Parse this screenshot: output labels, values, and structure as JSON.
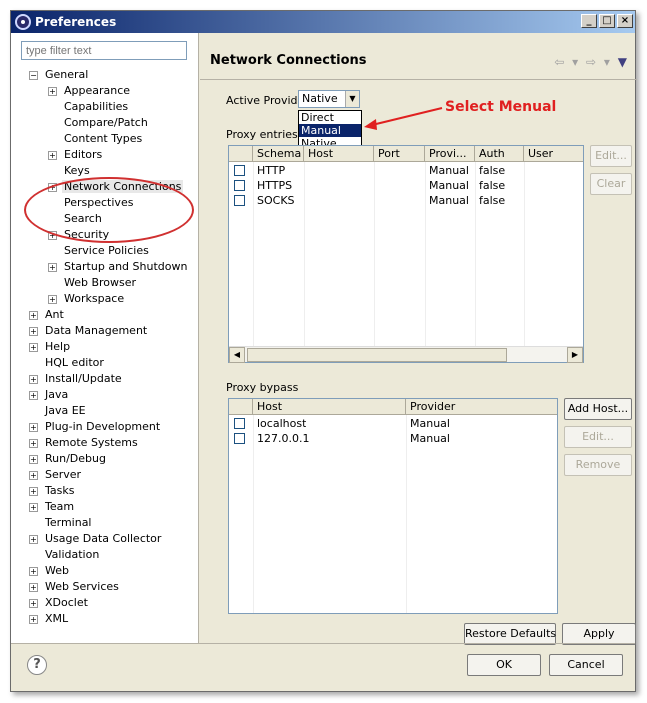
{
  "window": {
    "title": "Preferences",
    "controls": {
      "minimize": "_",
      "maximize": "□",
      "close": "×"
    }
  },
  "sidebar": {
    "filter_placeholder": "type filter text",
    "tree": [
      {
        "label": "General",
        "expander": "−",
        "level": 0
      },
      {
        "label": "Appearance",
        "expander": "+",
        "level": 1
      },
      {
        "label": "Capabilities",
        "expander": "",
        "level": 1
      },
      {
        "label": "Compare/Patch",
        "expander": "",
        "level": 1
      },
      {
        "label": "Content Types",
        "expander": "",
        "level": 1
      },
      {
        "label": "Editors",
        "expander": "+",
        "level": 1
      },
      {
        "label": "Keys",
        "expander": "",
        "level": 1
      },
      {
        "label": "Network Connections",
        "expander": "+",
        "level": 1,
        "selected": true
      },
      {
        "label": "Perspectives",
        "expander": "",
        "level": 1
      },
      {
        "label": "Search",
        "expander": "",
        "level": 1
      },
      {
        "label": "Security",
        "expander": "+",
        "level": 1
      },
      {
        "label": "Service Policies",
        "expander": "",
        "level": 1
      },
      {
        "label": "Startup and Shutdown",
        "expander": "+",
        "level": 1
      },
      {
        "label": "Web Browser",
        "expander": "",
        "level": 1
      },
      {
        "label": "Workspace",
        "expander": "+",
        "level": 1
      },
      {
        "label": "Ant",
        "expander": "+",
        "level": 0
      },
      {
        "label": "Data Management",
        "expander": "+",
        "level": 0
      },
      {
        "label": "Help",
        "expander": "+",
        "level": 0
      },
      {
        "label": "HQL editor",
        "expander": "",
        "level": 0
      },
      {
        "label": "Install/Update",
        "expander": "+",
        "level": 0
      },
      {
        "label": "Java",
        "expander": "+",
        "level": 0
      },
      {
        "label": "Java EE",
        "expander": "",
        "level": 0
      },
      {
        "label": "Plug-in Development",
        "expander": "+",
        "level": 0
      },
      {
        "label": "Remote Systems",
        "expander": "+",
        "level": 0
      },
      {
        "label": "Run/Debug",
        "expander": "+",
        "level": 0
      },
      {
        "label": "Server",
        "expander": "+",
        "level": 0
      },
      {
        "label": "Tasks",
        "expander": "+",
        "level": 0
      },
      {
        "label": "Team",
        "expander": "+",
        "level": 0
      },
      {
        "label": "Terminal",
        "expander": "",
        "level": 0
      },
      {
        "label": "Usage Data Collector",
        "expander": "+",
        "level": 0
      },
      {
        "label": "Validation",
        "expander": "",
        "level": 0
      },
      {
        "label": "Web",
        "expander": "+",
        "level": 0
      },
      {
        "label": "Web Services",
        "expander": "+",
        "level": 0
      },
      {
        "label": "XDoclet",
        "expander": "+",
        "level": 0
      },
      {
        "label": "XML",
        "expander": "+",
        "level": 0
      }
    ]
  },
  "main": {
    "title": "Network Connections",
    "nav": {
      "back": "⇦",
      "back_menu": "▾",
      "forward": "⇨",
      "forward_menu": "▾",
      "view_menu": "▼"
    },
    "active_provider": {
      "label": "Active Provider:",
      "value": "Native",
      "arrow": "▼",
      "options": [
        "Direct",
        "Manual",
        "Native"
      ],
      "highlighted": "Manual"
    },
    "annotation": "Select Menual",
    "proxy_entries": {
      "label": "Proxy entries",
      "columns": [
        "",
        "Schema",
        "Host",
        "Port",
        "Provi...",
        "Auth",
        "User"
      ],
      "rows": [
        [
          "HTTP",
          "",
          "",
          "Manual",
          "false",
          ""
        ],
        [
          "HTTPS",
          "",
          "",
          "Manual",
          "false",
          ""
        ],
        [
          "SOCKS",
          "",
          "",
          "Manual",
          "false",
          ""
        ]
      ],
      "scroll_left": "◀",
      "scroll_right": "▶",
      "edit_button": "Edit...",
      "clear_button": "Clear"
    },
    "proxy_bypass": {
      "label": "Proxy bypass",
      "columns": [
        "",
        "Host",
        "Provider"
      ],
      "rows": [
        [
          "localhost",
          "Manual"
        ],
        [
          "127.0.0.1",
          "Manual"
        ]
      ],
      "add_button": "Add Host...",
      "edit_button": "Edit...",
      "remove_button": "Remove"
    },
    "restore_defaults": "Restore Defaults",
    "apply": "Apply"
  },
  "footer": {
    "help": "?",
    "ok": "OK",
    "cancel": "Cancel"
  },
  "colors": {
    "titlebar_start": "#0a246a",
    "titlebar_end": "#a6caf0",
    "annotation": "#e02020",
    "selection": "#0a246a",
    "dialog_bg": "#ece9d8"
  }
}
